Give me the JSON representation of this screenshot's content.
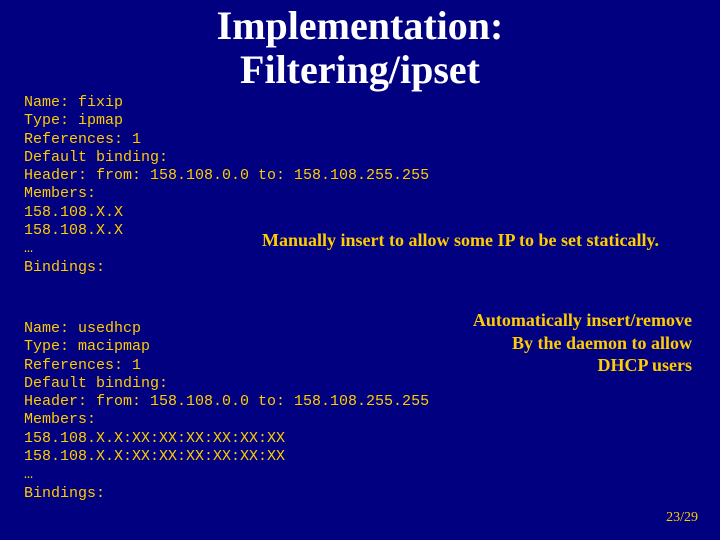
{
  "title_line1": "Implementation:",
  "title_line2": "Filtering/ipset",
  "block1": {
    "l0": "Name: fixip",
    "l1": "Type: ipmap",
    "l2": "References: 1",
    "l3": "Default binding:",
    "l4": "Header: from: 158.108.0.0 to: 158.108.255.255",
    "l5": "Members:",
    "l6": "158.108.X.X",
    "l7": "158.108.X.X",
    "l8": "…",
    "l9": "Bindings:"
  },
  "caption1": "Manually insert to allow some IP to be set statically.",
  "caption2_l1": "Automatically insert/remove",
  "caption2_l2": "By the daemon to allow",
  "caption2_l3": "DHCP users",
  "block2": {
    "l0": "Name: usedhcp",
    "l1": "Type: macipmap",
    "l2": "References: 1",
    "l3": "Default binding:",
    "l4": "Header: from: 158.108.0.0 to: 158.108.255.255",
    "l5": "Members:",
    "l6": "158.108.X.X:XX:XX:XX:XX:XX:XX",
    "l7": "158.108.X.X:XX:XX:XX:XX:XX:XX",
    "l8": "…",
    "l9": "Bindings:"
  },
  "pagenum": "23/29"
}
